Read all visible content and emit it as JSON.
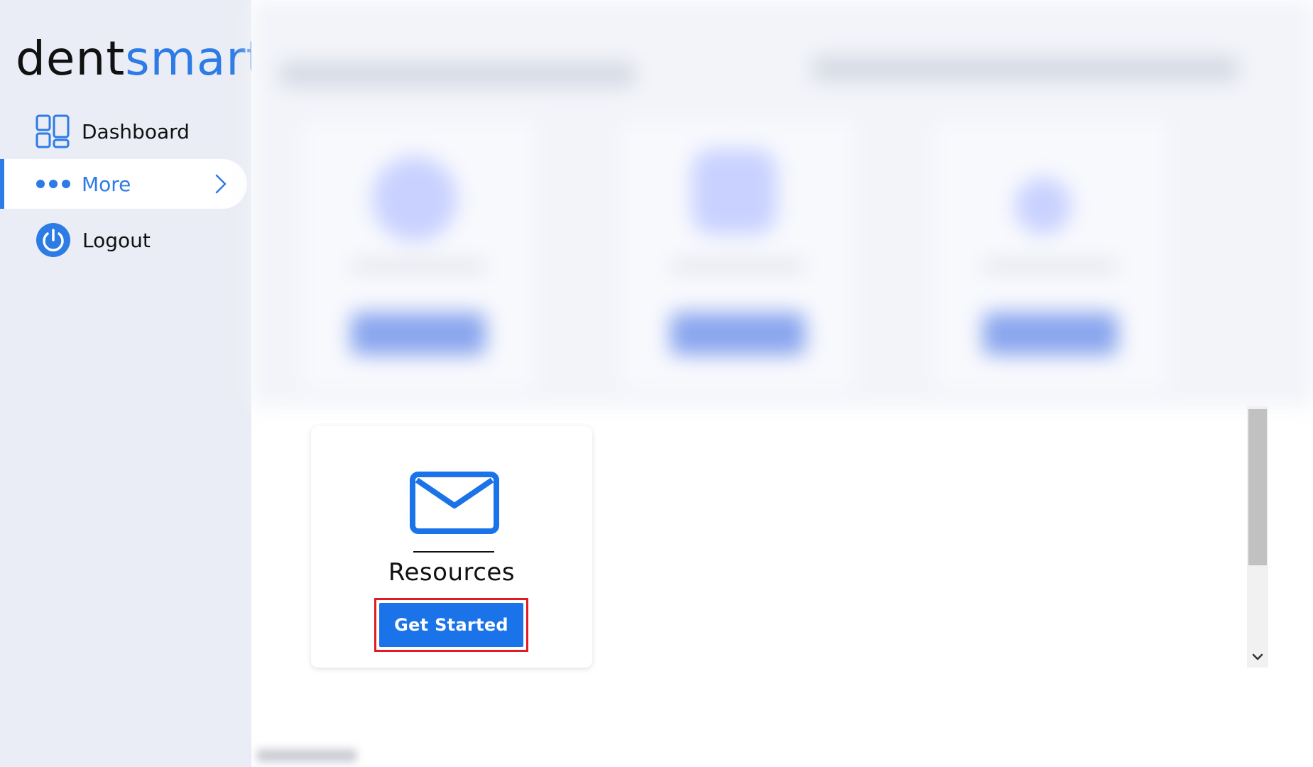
{
  "brand": {
    "part1": "dent",
    "part2": "smart"
  },
  "sidebar": {
    "items": [
      {
        "label": "Dashboard",
        "icon": "dashboard-grid-icon"
      },
      {
        "label": "More",
        "icon": "dots-icon",
        "active": true
      },
      {
        "label": "Logout",
        "icon": "power-icon"
      }
    ]
  },
  "card": {
    "icon": "mail-icon",
    "title": "Resources",
    "button_label": "Get Started"
  },
  "colors": {
    "accent": "#2d7be5",
    "button": "#1a73e8",
    "highlight": "#e01b24",
    "sidebar_bg": "#eaedf5"
  }
}
